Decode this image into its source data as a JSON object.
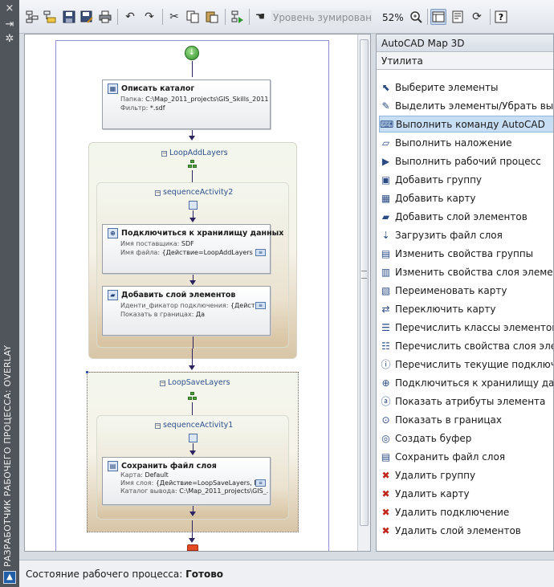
{
  "window": {
    "vertical_title": "РАЗРАБОТЧИК РАБОЧЕГО ПРОЦЕССА: OVERLAY"
  },
  "toolbar": {
    "zoom_label": "Уровень зумирования",
    "zoom_value": "52%",
    "icons": [
      "new-workflow-icon",
      "open-workflow-icon",
      "save-icon",
      "save-as-icon",
      "print-icon",
      "undo-icon",
      "redo-icon",
      "cut-icon",
      "copy-icon",
      "paste-icon",
      "run-workflow-icon",
      "zoom-hand-icon",
      "zoom-icon",
      "layout-icon-1",
      "layout-icon-2",
      "refresh-icon",
      "help-icon"
    ]
  },
  "workflow": {
    "activity_describe": {
      "title": "Описать каталог",
      "folder_label": "Папка:",
      "folder_value": "C:\\Map_2011_projects\\GIS_Skills_2011...",
      "filter_label": "Фильтр:",
      "filter_value": "*.sdf"
    },
    "loop_add": {
      "title": "LoopAddLayers"
    },
    "sequence2": {
      "title": "sequenceActivity2"
    },
    "activity_connect": {
      "title": "Подключиться к хранилищу данных",
      "provider_label": "Имя поставщика:",
      "provider_value": "SDF",
      "file_label": "Имя файла:",
      "file_value": "{Действие=LoopAddLayers, П..."
    },
    "activity_addlayer": {
      "title": "Добавить слой элементов",
      "conn_label": "Иденти_фикатор подключения:",
      "conn_value": "{Действи...",
      "bounds_label": "Показать в границах:",
      "bounds_value": "Да"
    },
    "loop_save": {
      "title": "LoopSaveLayers"
    },
    "sequence1": {
      "title": "sequenceActivity1"
    },
    "activity_savelayer": {
      "title": "Сохранить файл слоя",
      "map_label": "Карта:",
      "map_value": "Default",
      "layer_label": "Имя слоя:",
      "layer_value": "{Действие=LoopSaveLayers, Пу...",
      "catalog_label": "Каталог вывода:",
      "catalog_value": "C:\\Map_2011_projects\\GIS_..."
    }
  },
  "panel": {
    "title": "AutoCAD Map 3D",
    "category": "Утилита",
    "items": [
      {
        "label": "Выберите элементы",
        "icon": "select-icon"
      },
      {
        "label": "Выделить элементы/Убрать выделение",
        "icon": "highlight-icon"
      },
      {
        "label": "Выполнить команду AutoCAD",
        "icon": "command-icon"
      },
      {
        "label": "Выполнить наложение",
        "icon": "overlay-icon"
      },
      {
        "label": "Выполнить рабочий процесс",
        "icon": "run-workflow-icon"
      },
      {
        "label": "Добавить группу",
        "icon": "add-group-icon"
      },
      {
        "label": "Добавить карту",
        "icon": "add-map-icon"
      },
      {
        "label": "Добавить слой элементов",
        "icon": "add-layer-icon"
      },
      {
        "label": "Загрузить файл слоя",
        "icon": "load-layer-icon"
      },
      {
        "label": "Изменить свойства группы",
        "icon": "group-props-icon"
      },
      {
        "label": "Изменить свойства слоя элементов",
        "icon": "layer-props-icon"
      },
      {
        "label": "Переименовать карту",
        "icon": "rename-map-icon"
      },
      {
        "label": "Переключить карту",
        "icon": "switch-map-icon"
      },
      {
        "label": "Перечислить классы элементов",
        "icon": "list-classes-icon"
      },
      {
        "label": "Перечислить свойства слоя элементов",
        "icon": "list-layer-props-icon"
      },
      {
        "label": "Перечислить текущие подключения",
        "icon": "list-connections-icon"
      },
      {
        "label": "Подключиться к хранилищу данных",
        "icon": "connect-icon"
      },
      {
        "label": "Показать атрибуты элемента",
        "icon": "attributes-icon"
      },
      {
        "label": "Показать в границах",
        "icon": "zoom-extents-icon"
      },
      {
        "label": "Создать буфер",
        "icon": "buffer-icon"
      },
      {
        "label": "Сохранить файл слоя",
        "icon": "save-layer-icon"
      },
      {
        "label": "Удалить группу",
        "icon": "remove-group-icon"
      },
      {
        "label": "Удалить карту",
        "icon": "remove-map-icon"
      },
      {
        "label": "Удалить подключение",
        "icon": "remove-connection-icon"
      },
      {
        "label": "Удалить слой элементов",
        "icon": "remove-layer-icon"
      }
    ],
    "highlighted_index": 2
  },
  "status": {
    "label": "Состояние рабочего процесса: ",
    "value": "Готово"
  }
}
